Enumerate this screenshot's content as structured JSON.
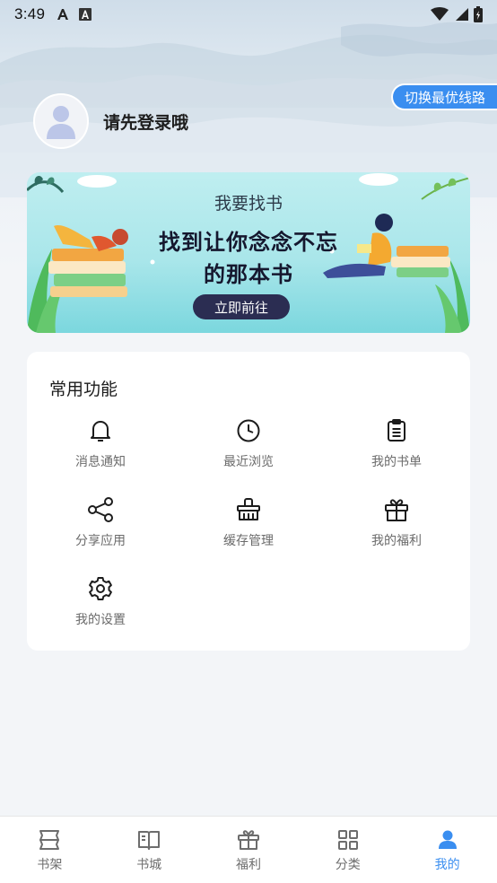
{
  "status_bar": {
    "time": "3:49",
    "left_icons": [
      "font-a-icon",
      "font-a-box-icon"
    ],
    "right_icons": [
      "wifi-icon",
      "signal-icon",
      "battery-icon"
    ]
  },
  "header": {
    "route_button_label": "切换最优线路",
    "login_prompt": "请先登录哦"
  },
  "banner": {
    "title": "我要找书",
    "line1": "找到让你念念不忘",
    "line2": "的那本书",
    "button_label": "立即前往"
  },
  "functions": {
    "title": "常用功能",
    "items": [
      {
        "label": "消息通知",
        "icon": "bell-icon"
      },
      {
        "label": "最近浏览",
        "icon": "clock-icon"
      },
      {
        "label": "我的书单",
        "icon": "clipboard-icon"
      },
      {
        "label": "分享应用",
        "icon": "share-icon"
      },
      {
        "label": "缓存管理",
        "icon": "basket-icon"
      },
      {
        "label": "我的福利",
        "icon": "gift-icon"
      },
      {
        "label": "我的设置",
        "icon": "gear-icon"
      }
    ]
  },
  "bottom_nav": {
    "items": [
      {
        "label": "书架",
        "icon": "bookshelf-icon"
      },
      {
        "label": "书城",
        "icon": "open-book-icon"
      },
      {
        "label": "福利",
        "icon": "gift-icon"
      },
      {
        "label": "分类",
        "icon": "grid-icon"
      },
      {
        "label": "我的",
        "icon": "person-icon"
      }
    ],
    "active": "我的"
  },
  "colors": {
    "accent": "#3a8ef0",
    "banner_button": "#2b2d52",
    "page_background": "#f3f5f8"
  }
}
